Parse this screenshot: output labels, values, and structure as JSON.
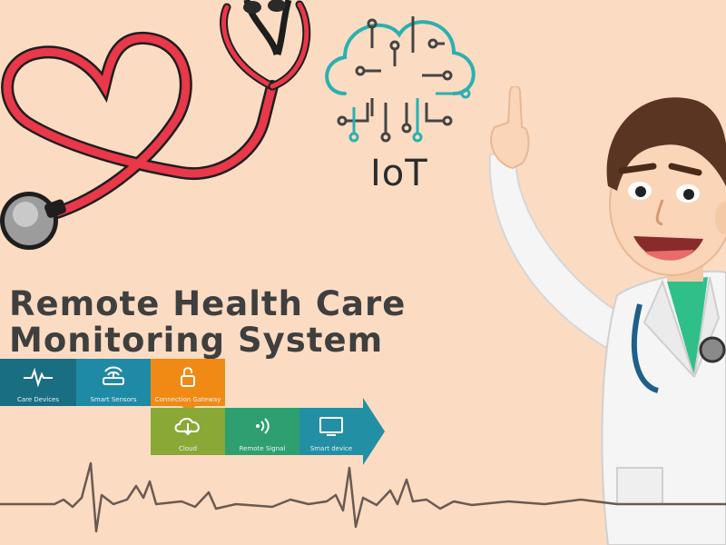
{
  "title": {
    "line1": "Remote Health Care",
    "line2": "Monitoring System"
  },
  "iot": {
    "label": "IoT",
    "icon": "cloud-circuit-icon",
    "color": "#2bb0b0"
  },
  "illustration": {
    "stethoscope": "heart-stethoscope-icon",
    "doctor": "doctor-pointing-illustration",
    "heartbeat": "ecg-line-icon"
  },
  "flow": {
    "steps": [
      {
        "label": "Care Devices",
        "icon": "pulse-icon",
        "color": "#1a6e82"
      },
      {
        "label": "Smart Sensors",
        "icon": "router-icon",
        "color": "#1f8aa6"
      },
      {
        "label": "Connection Gateway",
        "icon": "lock-icon",
        "color": "#f08a14"
      },
      {
        "label": "Cloud",
        "icon": "cloud-download-icon",
        "color": "#8aa836"
      },
      {
        "label": "Remote  Signal",
        "icon": "signal-icon",
        "color": "#2e9f6f"
      },
      {
        "label": "Smart device",
        "icon": "monitor-icon",
        "color": "#228fa5"
      }
    ]
  },
  "colors": {
    "background": "#fbdcc3",
    "title": "#3f3f3f",
    "stethoscope": "#e8384a"
  }
}
